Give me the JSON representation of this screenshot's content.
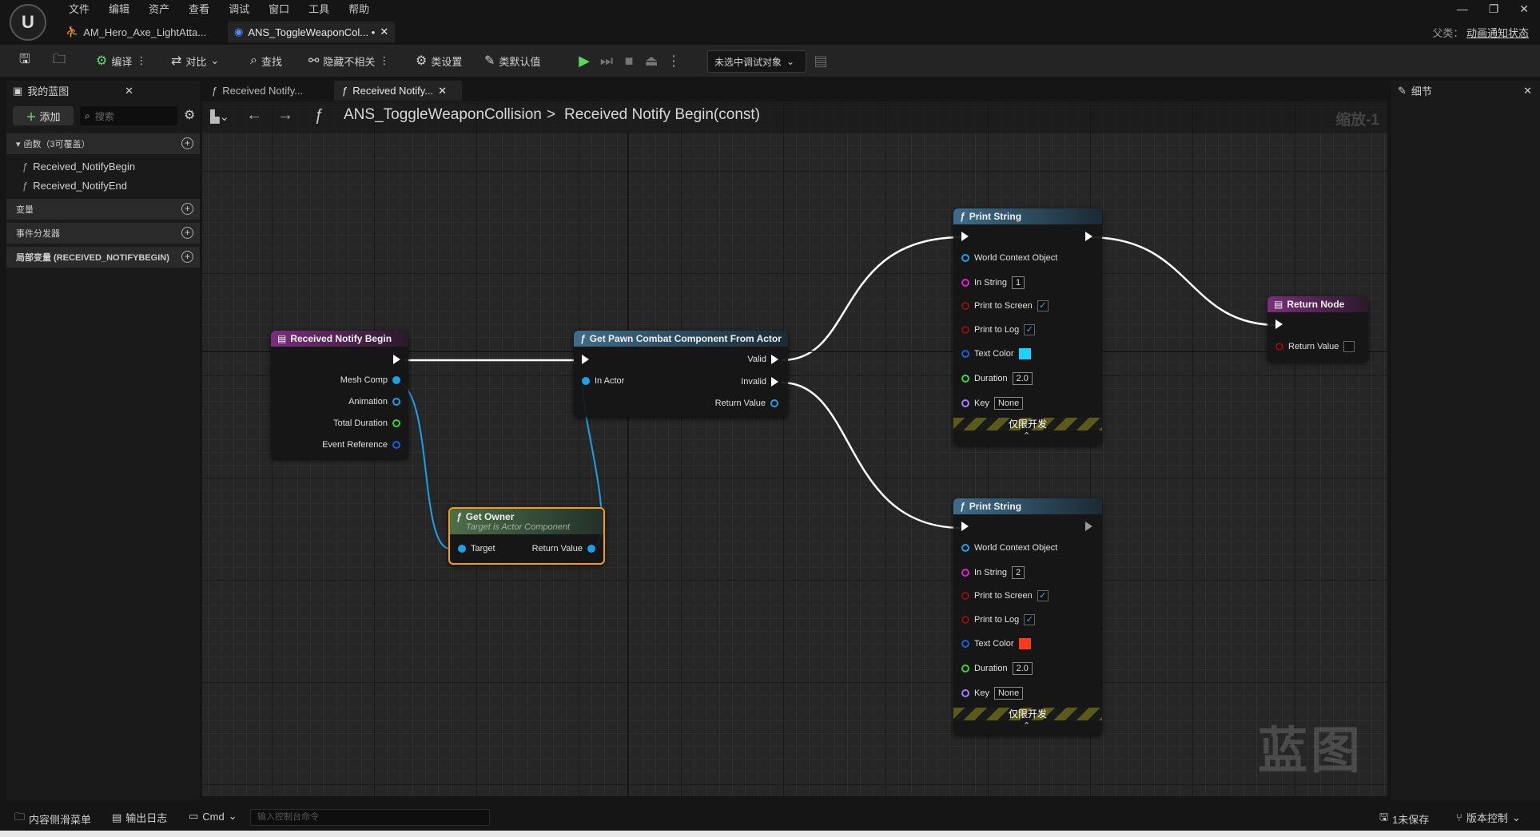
{
  "menu": [
    "文件",
    "编辑",
    "资产",
    "查看",
    "调试",
    "窗口",
    "工具",
    "帮助"
  ],
  "doc_tabs": [
    {
      "label": "AM_Hero_Axe_LightAtta..."
    },
    {
      "label": "ANS_ToggleWeaponCol... •"
    }
  ],
  "window": {
    "parent_label": "父类：",
    "parent_value": "动画通知状态"
  },
  "toolbar": {
    "compile": "编译",
    "diff": "对比",
    "find": "查找",
    "hide_unrelated": "隐藏不相关",
    "class_settings": "类设置",
    "class_defaults": "类默认值",
    "debug_select": "未选中调试对象"
  },
  "my_blueprint": {
    "tab_label": "我的蓝图",
    "add_label": "添加",
    "search_placeholder": "搜索",
    "functions_header": "函数（3可覆盖）",
    "functions": [
      "Received_NotifyBegin",
      "Received_NotifyEnd"
    ],
    "variables_header": "变量",
    "dispatchers_header": "事件分发器",
    "locals_header": "局部变量 (RECEIVED_NOTIFYBEGIN)"
  },
  "graph_tabs": [
    {
      "label": "Received Notify..."
    },
    {
      "label": "Received Notify..."
    }
  ],
  "breadcrumb": {
    "blueprint": "ANS_ToggleWeaponCollision",
    "sep": ">",
    "function": "Received Notify Begin(const)",
    "zoom": "缩放-1"
  },
  "watermark": "蓝图",
  "nodes": {
    "entry": {
      "title": "Received Notify Begin",
      "pins": [
        "Mesh Comp",
        "Animation",
        "Total Duration",
        "Event Reference"
      ]
    },
    "get_pawn": {
      "title": "Get Pawn Combat Component From Actor",
      "in_actor": "In Actor",
      "valid": "Valid",
      "invalid": "Invalid",
      "return_value": "Return Value"
    },
    "get_owner": {
      "title": "Get Owner",
      "subtitle": "Target is Actor Component",
      "target": "Target",
      "return_value": "Return Value"
    },
    "print1": {
      "title": "Print String",
      "world": "World Context Object",
      "in_string": "In String",
      "in_string_val": "1",
      "print_screen": "Print to Screen",
      "print_log": "Print to Log",
      "text_color": "Text Color",
      "color": "#19d4ff",
      "duration": "Duration",
      "duration_val": "2.0",
      "key": "Key",
      "key_val": "None",
      "dev": "仅限开发"
    },
    "print2": {
      "title": "Print String",
      "world": "World Context Object",
      "in_string": "In String",
      "in_string_val": "2",
      "print_screen": "Print to Screen",
      "print_log": "Print to Log",
      "text_color": "Text Color",
      "color": "#ff3a14",
      "duration": "Duration",
      "duration_val": "2.0",
      "key": "Key",
      "key_val": "None",
      "dev": "仅限开发"
    },
    "return": {
      "title": "Return Node",
      "return_value": "Return Value"
    }
  },
  "details": {
    "tab_label": "细节"
  },
  "bottom": {
    "content_drawer": "内容侧滑菜单",
    "output_log": "输出日志",
    "cmd": "Cmd",
    "cmd_placeholder": "输入控制台命令",
    "unsaved": "1未保存",
    "source_control": "版本控制"
  }
}
